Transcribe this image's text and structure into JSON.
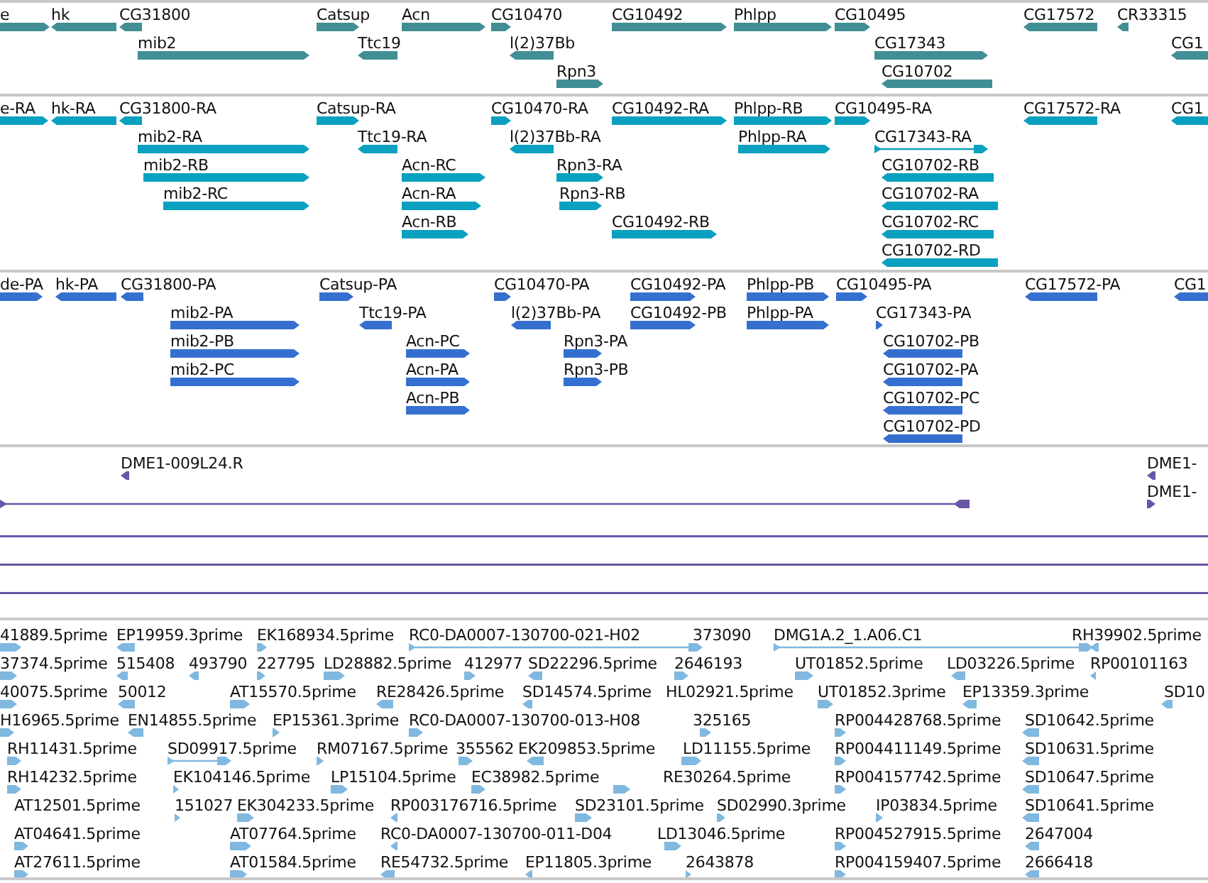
{
  "tracks": [
    {
      "kind": "gene",
      "features": [
        {
          "label": "e",
          "reverse": false
        },
        {
          "label": "hk",
          "reverse": true
        },
        {
          "label": "CG31800",
          "reverse": true
        },
        {
          "label": "Catsup",
          "reverse": false
        },
        {
          "label": "Acn",
          "reverse": false
        },
        {
          "label": "CG10470",
          "reverse": false
        },
        {
          "label": "CG10492",
          "reverse": false
        },
        {
          "label": "Phlpp",
          "reverse": false
        },
        {
          "label": "CG10495",
          "reverse": false
        },
        {
          "label": "CG17572",
          "reverse": true
        },
        {
          "label": "CR33315",
          "reverse": true
        },
        {
          "label": "mib2",
          "reverse": false
        },
        {
          "label": "Ttc19",
          "reverse": true
        },
        {
          "label": "l(2)37Bb",
          "reverse": true
        },
        {
          "label": "CG17343",
          "reverse": false
        },
        {
          "label": "CG1",
          "reverse": true
        },
        {
          "label": "Rpn3",
          "reverse": false
        },
        {
          "label": "CG10702",
          "reverse": true
        }
      ]
    },
    {
      "kind": "transcript",
      "features": [
        {
          "label": "e-RA",
          "reverse": false
        },
        {
          "label": "hk-RA",
          "reverse": true
        },
        {
          "label": "CG31800-RA",
          "reverse": true
        },
        {
          "label": "Catsup-RA",
          "reverse": false
        },
        {
          "label": "CG10470-RA",
          "reverse": false
        },
        {
          "label": "CG10492-RA",
          "reverse": false
        },
        {
          "label": "Phlpp-RB",
          "reverse": false
        },
        {
          "label": "CG10495-RA",
          "reverse": false
        },
        {
          "label": "CG17572-RA",
          "reverse": true
        },
        {
          "label": "CG1",
          "reverse": true
        },
        {
          "label": "mib2-RA",
          "reverse": false
        },
        {
          "label": "Ttc19-RA",
          "reverse": true
        },
        {
          "label": "l(2)37Bb-RA",
          "reverse": true
        },
        {
          "label": "Phlpp-RA",
          "reverse": false
        },
        {
          "label": "CG17343-RA",
          "reverse": false
        },
        {
          "label": "mib2-RB",
          "reverse": false
        },
        {
          "label": "Acn-RC",
          "reverse": false
        },
        {
          "label": "Rpn3-RA",
          "reverse": false
        },
        {
          "label": "CG10702-RB",
          "reverse": true
        },
        {
          "label": "mib2-RC",
          "reverse": false
        },
        {
          "label": "Acn-RA",
          "reverse": false
        },
        {
          "label": "Rpn3-RB",
          "reverse": false
        },
        {
          "label": "CG10702-RA",
          "reverse": true
        },
        {
          "label": "Acn-RB",
          "reverse": false
        },
        {
          "label": "CG10492-RB",
          "reverse": false
        },
        {
          "label": "CG10702-RC",
          "reverse": true
        },
        {
          "label": "CG10702-RD",
          "reverse": true
        }
      ]
    },
    {
      "kind": "protein",
      "features": [
        {
          "label": "de-PA",
          "reverse": false
        },
        {
          "label": "hk-PA",
          "reverse": true
        },
        {
          "label": "CG31800-PA",
          "reverse": true
        },
        {
          "label": "Catsup-PA",
          "reverse": false
        },
        {
          "label": "CG10470-PA",
          "reverse": false
        },
        {
          "label": "CG10492-PA",
          "reverse": false
        },
        {
          "label": "Phlpp-PB",
          "reverse": false
        },
        {
          "label": "CG10495-PA",
          "reverse": false
        },
        {
          "label": "CG17572-PA",
          "reverse": true
        },
        {
          "label": "CG1",
          "reverse": true
        },
        {
          "label": "mib2-PA",
          "reverse": false
        },
        {
          "label": "Ttc19-PA",
          "reverse": true
        },
        {
          "label": "l(2)37Bb-PA",
          "reverse": true
        },
        {
          "label": "CG10492-PB",
          "reverse": false
        },
        {
          "label": "Phlpp-PA",
          "reverse": false
        },
        {
          "label": "CG17343-PA",
          "reverse": false
        },
        {
          "label": "mib2-PB",
          "reverse": false
        },
        {
          "label": "Acn-PC",
          "reverse": false
        },
        {
          "label": "Rpn3-PA",
          "reverse": false
        },
        {
          "label": "CG10702-PB",
          "reverse": true
        },
        {
          "label": "mib2-PC",
          "reverse": false
        },
        {
          "label": "Acn-PA",
          "reverse": false
        },
        {
          "label": "Rpn3-PB",
          "reverse": false
        },
        {
          "label": "CG10702-PA",
          "reverse": true
        },
        {
          "label": "Acn-PB",
          "reverse": false
        },
        {
          "label": "CG10702-PC",
          "reverse": true
        },
        {
          "label": "CG10702-PD",
          "reverse": true
        }
      ]
    },
    {
      "kind": "alignment",
      "features": [
        {
          "label": "DME1-009L24.R",
          "reverse": true
        },
        {
          "label": "DME1-",
          "reverse": true
        },
        {
          "reverse": true
        },
        {
          "label": "DME1-",
          "reverse": false
        }
      ]
    },
    {
      "kind": "est",
      "features": [
        {
          "label": "41889.5prime",
          "reverse": false
        },
        {
          "label": "EP19959.3prime",
          "reverse": true
        },
        {
          "label": "EK168934.5prime",
          "reverse": false
        },
        {
          "label": "RC0-DA0007-130700-021-H02",
          "reverse": false
        },
        {
          "label": "373090"
        },
        {
          "label": "DMG1A.2_1.A06.C1",
          "reverse": false
        },
        {
          "label": "RH39902.5prime",
          "reverse": true
        },
        {
          "label": "37374.5prime",
          "reverse": false
        },
        {
          "label": "515408",
          "reverse": true
        },
        {
          "label": "493790",
          "reverse": true
        },
        {
          "label": "227795",
          "reverse": false
        },
        {
          "label": "LD28882.5prime",
          "reverse": false
        },
        {
          "label": "412977",
          "reverse": false
        },
        {
          "label": "SD22296.5prime",
          "reverse": true
        },
        {
          "label": "2646193",
          "reverse": false
        },
        {
          "label": "UT01852.5prime",
          "reverse": false
        },
        {
          "label": "LD03226.5prime",
          "reverse": true
        },
        {
          "label": "RP00101163",
          "reverse": true
        },
        {
          "label": "40075.5prime",
          "reverse": false
        },
        {
          "label": "50012",
          "reverse": true
        },
        {
          "label": "AT15570.5prime",
          "reverse": false
        },
        {
          "label": "RE28426.5prime",
          "reverse": true
        },
        {
          "label": "SD14574.5prime",
          "reverse": true
        },
        {
          "label": "HL02921.5prime"
        },
        {
          "label": "UT01852.3prime",
          "reverse": false
        },
        {
          "label": "EP13359.3prime",
          "reverse": true
        },
        {
          "label": "SD10",
          "reverse": true
        },
        {
          "label": "H16965.5prime",
          "reverse": false
        },
        {
          "label": "EN14855.5prime",
          "reverse": true
        },
        {
          "label": "EP15361.3prime",
          "reverse": false
        },
        {
          "label": "RC0-DA0007-130700-013-H08",
          "reverse": false
        },
        {
          "label": "325165",
          "reverse": false
        },
        {
          "label": "RP004428768.5prime",
          "reverse": false
        },
        {
          "label": "SD10642.5prime",
          "reverse": true
        },
        {
          "label": "RH11431.5prime",
          "reverse": false
        },
        {
          "label": "SD09917.5prime",
          "reverse": false
        },
        {
          "label": "RM07167.5prime",
          "reverse": false
        },
        {
          "label": "355562",
          "reverse": false
        },
        {
          "label": "EK209853.5prime",
          "reverse": true
        },
        {
          "label": "LD11155.5prime",
          "reverse": false
        },
        {
          "label": "RP004411149.5prime",
          "reverse": false
        },
        {
          "label": "SD10631.5prime",
          "reverse": true
        },
        {
          "label": "RH14232.5prime",
          "reverse": false
        },
        {
          "label": "EK104146.5prime",
          "reverse": false
        },
        {
          "label": "LP15104.5prime",
          "reverse": false
        },
        {
          "label": "EC38982.5prime",
          "reverse": false
        },
        {
          "label": "RE30264.5prime",
          "reverse": false
        },
        {
          "label": "RP004157742.5prime",
          "reverse": false
        },
        {
          "label": "SD10647.5prime",
          "reverse": true
        },
        {
          "label": "AT12501.5prime"
        },
        {
          "label": "151027",
          "reverse": false
        },
        {
          "label": "EK304233.5prime",
          "reverse": false
        },
        {
          "label": "RP003176716.5prime",
          "reverse": true
        },
        {
          "label": "SD23101.5prime",
          "reverse": false
        },
        {
          "label": "SD02990.3prime",
          "reverse": false
        },
        {
          "label": "IP03834.5prime",
          "reverse": false
        },
        {
          "label": "SD10641.5prime",
          "reverse": true
        },
        {
          "label": "AT04641.5prime",
          "reverse": false
        },
        {
          "label": "AT07764.5prime",
          "reverse": false
        },
        {
          "label": "RC0-DA0007-130700-011-D04",
          "reverse": true
        },
        {
          "label": "LD13046.5prime",
          "reverse": false
        },
        {
          "label": "RP004527915.5prime",
          "reverse": false
        },
        {
          "label": "2647004",
          "reverse": true
        },
        {
          "label": "AT27611.5prime",
          "reverse": false
        },
        {
          "label": "AT01584.5prime",
          "reverse": false
        },
        {
          "label": "RE54732.5prime",
          "reverse": true
        },
        {
          "label": "EP11805.3prime",
          "reverse": true
        },
        {
          "label": "2643878",
          "reverse": false
        },
        {
          "label": "RP004159407.5prime",
          "reverse": false
        },
        {
          "label": "2666418",
          "reverse": true
        }
      ]
    }
  ]
}
